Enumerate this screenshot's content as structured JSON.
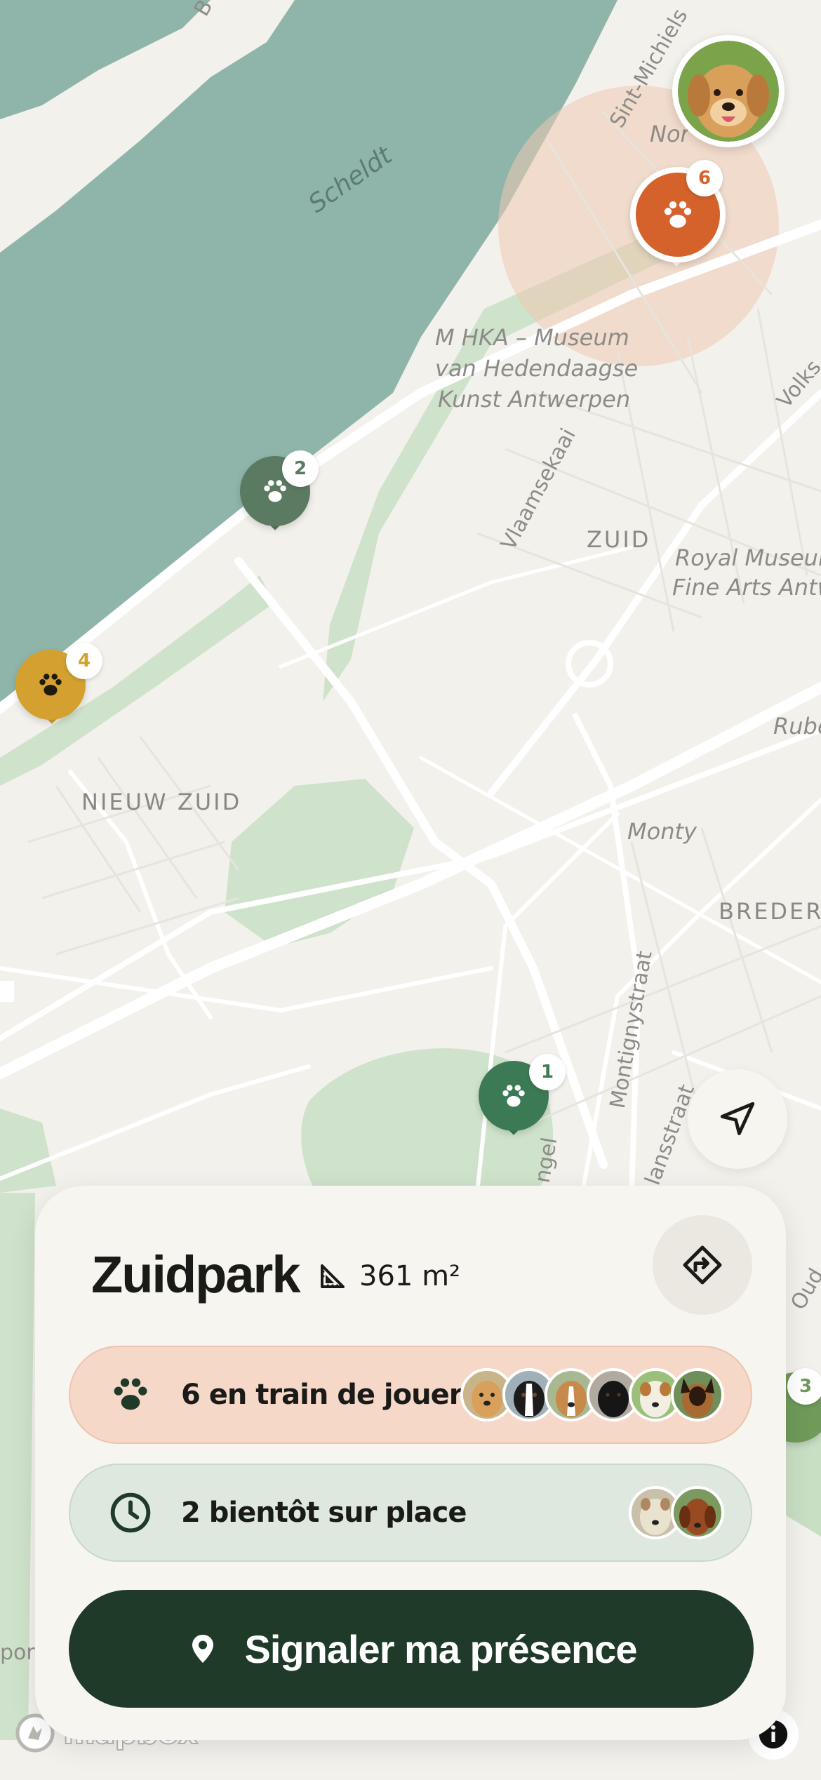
{
  "map": {
    "water_label": "Scheldt",
    "museum_label_1": "M HKA – Museum",
    "museum_label_2": "van Hedendaagse",
    "museum_label_3": "Kunst Antwerpen",
    "royal_label_1": "Royal Museum",
    "royal_label_2": "Fine Arts Antw",
    "district_zuid": "ZUID",
    "district_nieuw_zuid": "NIEUW ZUID",
    "district_breder": "BREDER",
    "place_monty": "Monty",
    "street_vlaamsekaai": "Vlaamsekaai",
    "street_sint_michiels": "Sint-Michiels",
    "street_montigny": "Montignystraat",
    "street_volks": "Volks",
    "street_rube": "Rube",
    "street_nor": "Nor",
    "street_ngel": "ngel",
    "street_lansstraat": "lansstraat",
    "street_oud": "Oud",
    "street_por": "por",
    "street_b": "B",
    "pins": [
      {
        "count": "6",
        "color": "#d4622a",
        "kind": "paw"
      },
      {
        "count": "2",
        "color": "#5a7a62",
        "kind": "paw"
      },
      {
        "count": "4",
        "color": "#d4a030",
        "kind": "paw"
      },
      {
        "count": "1",
        "color": "#3c7a55",
        "kind": "paw"
      },
      {
        "count": "3",
        "color": "#6f9a5a",
        "kind": "paw"
      }
    ],
    "attribution": "mapbox"
  },
  "park": {
    "name": "Zuidpark",
    "area": "361 m²",
    "area_icon": "ruler-triangle-icon",
    "directions_icon": "directions-icon"
  },
  "status": {
    "playing_label": "6 en train de jouer",
    "playing_icon": "paw-icon",
    "playing_avatars": [
      "golden-retriever",
      "border-collie",
      "beagle",
      "black-labrador",
      "jack-russell",
      "german-shepherd"
    ],
    "soon_label": "2 bientôt sur place",
    "soon_icon": "clock-icon",
    "soon_avatars": [
      "terrier",
      "dachshund"
    ]
  },
  "cta": {
    "label": "Signaler ma présence",
    "icon": "location-pin-icon"
  },
  "colors": {
    "primary_dark": "#1f3a29",
    "playing_bg": "#f5d8c8",
    "soon_bg": "#dfe8df",
    "water": "#8fb5ab",
    "park_green": "#c9dfc4",
    "accent_orange": "#d4622a"
  }
}
